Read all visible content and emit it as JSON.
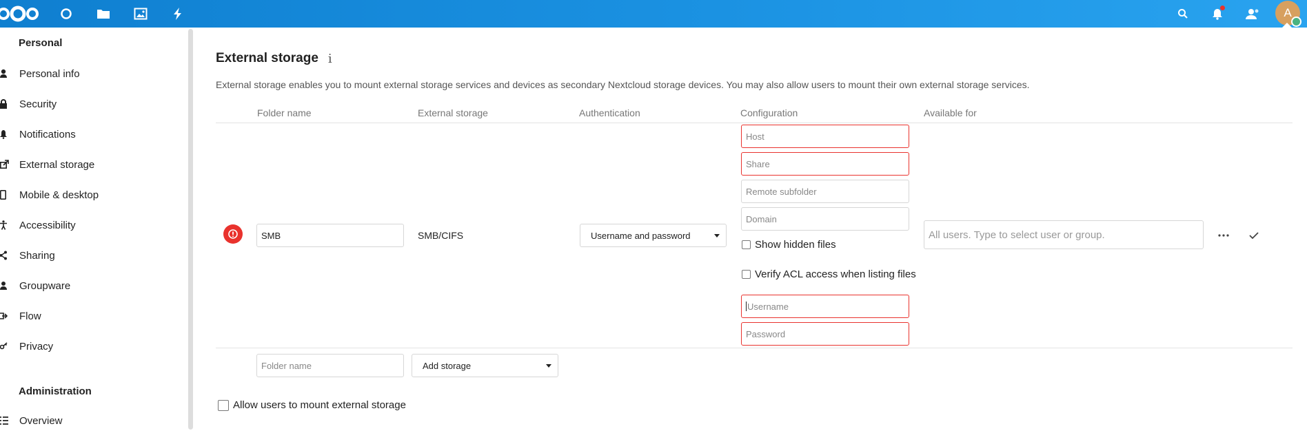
{
  "header": {
    "icons": [
      "nextcloud-logo",
      "dashboard-icon",
      "files-icon",
      "photos-icon",
      "activity-icon",
      "search-icon",
      "notifications-icon",
      "contacts-icon"
    ],
    "avatar_initial": "A",
    "colors": {
      "bar_start": "#0f7fd0",
      "bar_end": "#29a3ef",
      "avatar": "#d7a05f",
      "status": "#49b382"
    }
  },
  "sidebar": {
    "personal_heading": "Personal",
    "items": [
      {
        "label": "Personal info",
        "icon": "user-icon"
      },
      {
        "label": "Security",
        "icon": "lock-icon"
      },
      {
        "label": "Notifications",
        "icon": "bell-icon"
      },
      {
        "label": "External storage",
        "icon": "external-link-icon"
      },
      {
        "label": "Mobile & desktop",
        "icon": "phone-icon"
      },
      {
        "label": "Accessibility",
        "icon": "accessibility-icon"
      },
      {
        "label": "Sharing",
        "icon": "share-icon"
      },
      {
        "label": "Groupware",
        "icon": "groupware-icon"
      },
      {
        "label": "Flow",
        "icon": "flow-icon"
      },
      {
        "label": "Privacy",
        "icon": "key-icon"
      }
    ],
    "admin_heading": "Administration",
    "admin_items": [
      {
        "label": "Overview",
        "icon": "list-icon"
      }
    ]
  },
  "main": {
    "title": "External storage",
    "description": "External storage enables you to mount external storage services and devices as secondary Nextcloud storage devices. You may also allow users to mount their own external storage services.",
    "columns": [
      "Folder name",
      "External storage",
      "Authentication",
      "Configuration",
      "Available for"
    ],
    "mount": {
      "folder_name": "SMB",
      "backend": "SMB/CIFS",
      "auth": "Username and password",
      "config": {
        "host_placeholder": "Host",
        "share_placeholder": "Share",
        "subfolder_placeholder": "Remote subfolder",
        "domain_placeholder": "Domain",
        "show_hidden": "Show hidden files",
        "verify_acl": "Verify ACL access when listing files",
        "username_placeholder": "Username",
        "password_placeholder": "Password"
      },
      "available_for_placeholder": "All users. Type to select user or group."
    },
    "new_row": {
      "folder_placeholder": "Folder name",
      "add_storage": "Add storage"
    },
    "allow_users_label": "Allow users to mount external storage",
    "colors": {
      "error": "#e9322d"
    }
  }
}
